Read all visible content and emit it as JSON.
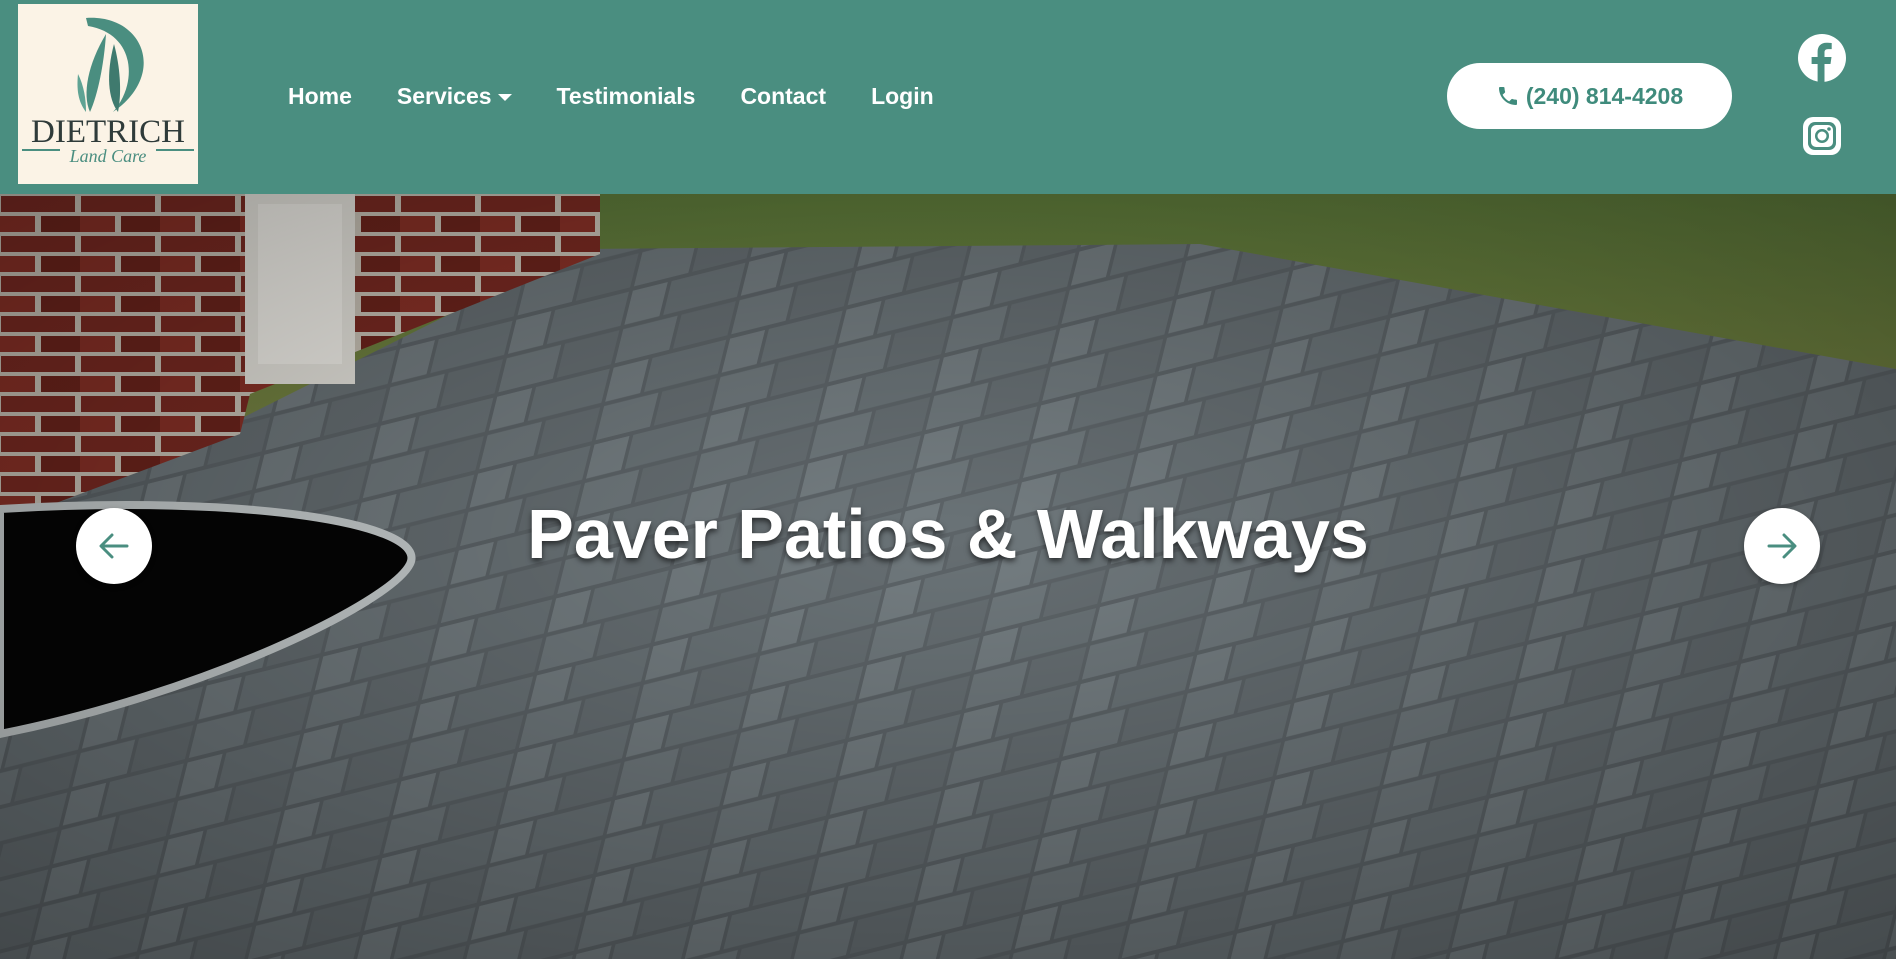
{
  "brand": {
    "name": "DIETRICH",
    "tagline": "Land Care",
    "colors": {
      "primary": "#4a8e80",
      "logo_bg": "#fbf3e6",
      "logo_ink": "#2f3b3a"
    }
  },
  "nav": {
    "items": [
      {
        "label": "Home"
      },
      {
        "label": "Services",
        "has_dropdown": true
      },
      {
        "label": "Testimonials"
      },
      {
        "label": "Contact"
      },
      {
        "label": "Login"
      }
    ]
  },
  "phone": {
    "label": "(240) 814-4208",
    "icon": "phone-icon"
  },
  "social": [
    {
      "icon": "facebook-icon"
    },
    {
      "icon": "instagram-icon"
    }
  ],
  "hero": {
    "title": "Paver Patios & Walkways",
    "prev_icon": "arrow-left-icon",
    "next_icon": "arrow-right-icon"
  }
}
